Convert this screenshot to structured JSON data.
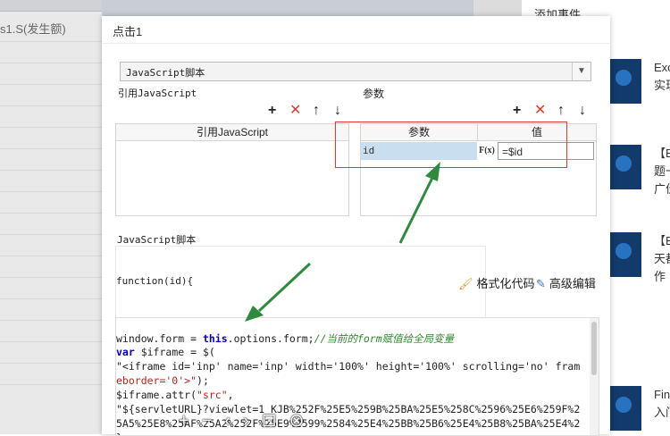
{
  "background": {
    "left_label": "s1.S(发生额)",
    "right_add_event": "添加事件",
    "right_items": [
      {
        "text": "Exc\n实现"
      },
      {
        "text": "【Ex\n题一\n广佳"
      },
      {
        "text": "【En\n天都\n作"
      },
      {
        "text": "Fin\n入门"
      }
    ]
  },
  "dialog": {
    "title": "点击1",
    "select_value": "JavaScript脚本",
    "ref_js_label": "引用JavaScript",
    "params_label": "参数",
    "ref_table_header": "引用JavaScript",
    "params_header": "参数",
    "value_header": "值",
    "param_name": "id",
    "formula_icon": "F(x)",
    "param_value": "=$id",
    "script_label": "JavaScript脚本",
    "function_sig": "function(id){",
    "format_code": "格式化代码",
    "advanced_edit": "高级编辑",
    "code_lines": [
      "window.form = this.options.form;//当前的form赋值给全局变量",
      "var $iframe = $(",
      "\"<iframe id='inp' name='inp' width='100%' height='100%' scrolling='no' fram",
      "eborder='0'>\");",
      "$iframe.attr(\"src\",",
      "\"${servletURL}?viewlet=1_KJB%252F%25E5%259B%25BA%25E5%258C%2596%25E6%259F%2",
      "5A5%25E8%25AF%25A2%252F%25E9%2599%2584%25E4%25BB%25B6%25E4%25B8%25BA%25E4%2",
      "}"
    ]
  },
  "toolbar_icons": [
    "plus-icon",
    "delete-icon",
    "arrow-up-icon",
    "arrow-down-icon"
  ],
  "zoom_controls": {
    "zoom_in": "+",
    "zoom_out": "−",
    "prev": "‹",
    "next": "›",
    "reset": "⊡",
    "close": "⊗"
  },
  "colors": {
    "highlight_red": "#e23a2a",
    "param_selected": "#c9dff0",
    "arrow_green": "#2e8b3e"
  }
}
